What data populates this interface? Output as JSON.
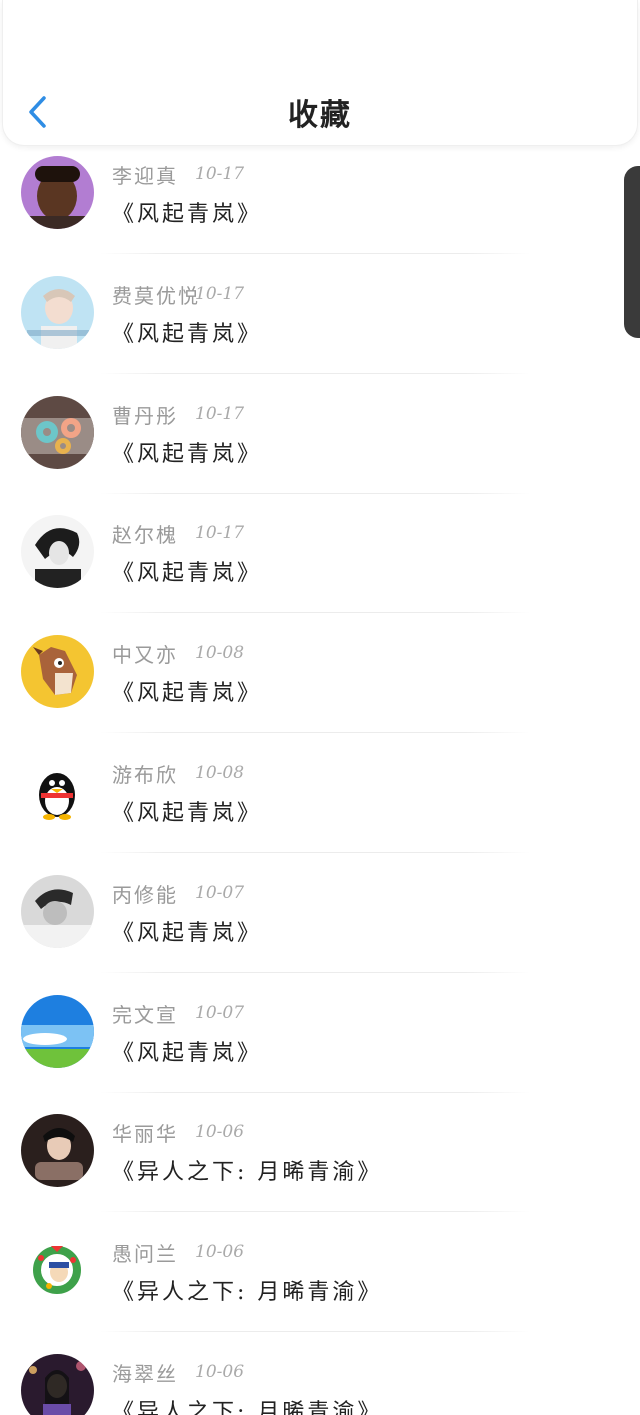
{
  "header": {
    "title": "收藏",
    "back_icon": "chevron-left-icon",
    "accent": "#2f8de4"
  },
  "favorites": [
    {
      "name": "李迎真",
      "date": "10-17",
      "title": "《风起青岚》",
      "avatar": "portrait-dark-icon"
    },
    {
      "name": "费莫优悦",
      "date": "10-17",
      "title": "《风起青岚》",
      "avatar": "portrait-light-icon"
    },
    {
      "name": "曹丹彤",
      "date": "10-17",
      "title": "《风起青岚》",
      "avatar": "donuts-icon"
    },
    {
      "name": "赵尔槐",
      "date": "10-17",
      "title": "《风起青岚》",
      "avatar": "portrait-bw-icon"
    },
    {
      "name": "中又亦",
      "date": "10-08",
      "title": "《风起青岚》",
      "avatar": "horse-cartoon-icon"
    },
    {
      "name": "游布欣",
      "date": "10-08",
      "title": "《风起青岚》",
      "avatar": "penguin-icon"
    },
    {
      "name": "丙修能",
      "date": "10-07",
      "title": "《风起青岚》",
      "avatar": "portrait-gray-icon"
    },
    {
      "name": "完文宣",
      "date": "10-07",
      "title": "《风起青岚》",
      "avatar": "sky-landscape-icon"
    },
    {
      "name": "华丽华",
      "date": "10-06",
      "title": "《异人之下: 月晞青渝》",
      "avatar": "portrait-scarf-icon"
    },
    {
      "name": "愚问兰",
      "date": "10-06",
      "title": "《异人之下: 月晞青渝》",
      "avatar": "wreath-cartoon-icon"
    },
    {
      "name": "海翠丝",
      "date": "10-06",
      "title": "《异人之下: 月晞青渝》",
      "avatar": "portrait-night-icon"
    }
  ]
}
